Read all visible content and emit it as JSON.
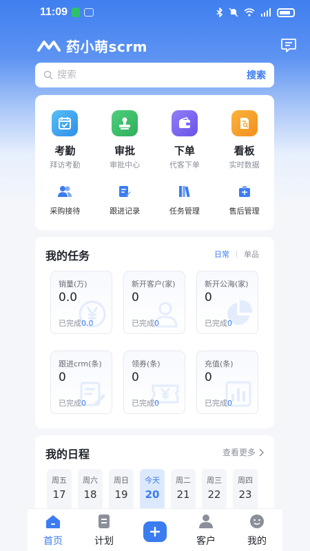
{
  "status_bar": {
    "time": "11:09"
  },
  "header": {
    "brand": "药小萌scrm"
  },
  "search": {
    "placeholder": "搜索",
    "button": "搜索"
  },
  "quick_main": [
    {
      "title": "考勤",
      "sub": "拜访考勤",
      "icon": "calendar-check-icon",
      "color": "#3aa7f0"
    },
    {
      "title": "审批",
      "sub": "审批中心",
      "icon": "stamp-icon",
      "color": "#3ec06a"
    },
    {
      "title": "下单",
      "sub": "代客下单",
      "icon": "wallet-icon",
      "color": "#7a68f0"
    },
    {
      "title": "看板",
      "sub": "实时数据",
      "icon": "document-search-icon",
      "color": "#f5a524"
    }
  ],
  "quick_sub": [
    {
      "label": "采购接待",
      "icon": "users-icon"
    },
    {
      "label": "跟进记录",
      "icon": "edit-note-icon"
    },
    {
      "label": "任务管理",
      "icon": "books-icon"
    },
    {
      "label": "售后管理",
      "icon": "service-box-icon"
    }
  ],
  "tasks": {
    "title": "我的任务",
    "tab_active": "日常",
    "tab_other": "单品",
    "done_label": "已完成",
    "items": [
      {
        "label": "销量(万)",
        "value": "0.0",
        "done": "0.0",
        "deco": "yuan-icon"
      },
      {
        "label": "新开客户(家)",
        "value": "0",
        "done": "0",
        "deco": "person-icon"
      },
      {
        "label": "新开公海(家)",
        "value": "0",
        "done": "0",
        "deco": "pie-icon"
      },
      {
        "label": "跟进crm(条)",
        "value": "0",
        "done": "0",
        "deco": "edit-icon"
      },
      {
        "label": "领券(条)",
        "value": "0",
        "done": "0",
        "deco": "coupon-icon"
      },
      {
        "label": "充值(条)",
        "value": "0",
        "done": "0",
        "deco": "bar-chart-icon"
      }
    ]
  },
  "schedule": {
    "title": "我的日程",
    "more": "查看更多",
    "days": [
      {
        "name": "周五",
        "num": "17"
      },
      {
        "name": "周六",
        "num": "18"
      },
      {
        "name": "周日",
        "num": "19"
      },
      {
        "name": "今天",
        "num": "20"
      },
      {
        "name": "周二",
        "num": "21"
      },
      {
        "name": "周三",
        "num": "22"
      },
      {
        "name": "周四",
        "num": "23"
      }
    ]
  },
  "tabbar": [
    {
      "label": "首页"
    },
    {
      "label": "计划"
    },
    {
      "label": ""
    },
    {
      "label": "客户"
    },
    {
      "label": "我的"
    }
  ],
  "colors": {
    "primary": "#3b7cf0",
    "header_gradient_top": "#3f7ff0"
  }
}
